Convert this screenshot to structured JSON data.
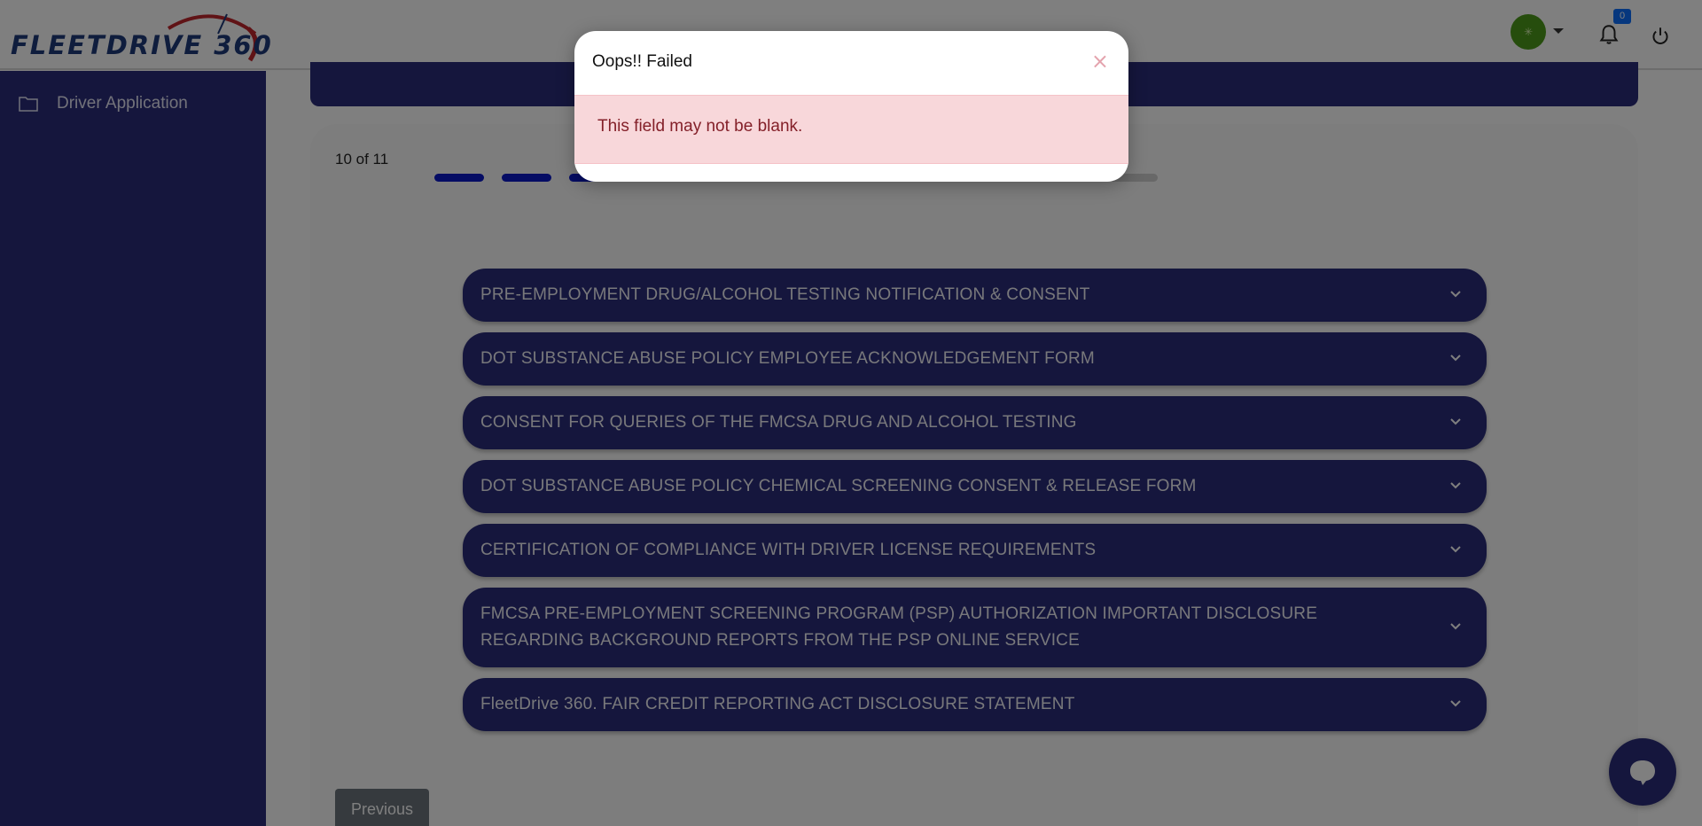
{
  "header": {
    "logo_text": "FLEETDRIVE 360",
    "notification_count": "0",
    "avatar_glyph": "✳"
  },
  "sidebar": {
    "items": [
      {
        "label": "Driver Application",
        "icon": "folder-icon"
      }
    ]
  },
  "main": {
    "step_text": "10 of 11",
    "progress": {
      "current": 10,
      "total": 11
    },
    "accordions": [
      {
        "label": "PRE-EMPLOYMENT DRUG/ALCOHOL TESTING NOTIFICATION & CONSENT"
      },
      {
        "label": "DOT SUBSTANCE ABUSE POLICY EMPLOYEE ACKNOWLEDGEMENT FORM"
      },
      {
        "label": "CONSENT FOR QUERIES OF THE FMCSA DRUG AND ALCOHOL TESTING"
      },
      {
        "label": "DOT SUBSTANCE ABUSE POLICY CHEMICAL SCREENING CONSENT & RELEASE FORM"
      },
      {
        "label": "CERTIFICATION OF COMPLIANCE WITH DRIVER LICENSE REQUIREMENTS"
      },
      {
        "label": "FMCSA PRE-EMPLOYMENT SCREENING PROGRAM (PSP) AUTHORIZATION IMPORTANT DISCLOSURE REGARDING BACKGROUND REPORTS FROM THE PSP ONLINE SERVICE"
      },
      {
        "label": "FleetDrive 360. FAIR CREDIT REPORTING ACT DISCLOSURE STATEMENT"
      }
    ],
    "previous_label": "Previous"
  },
  "modal": {
    "title": "Oops!! Failed",
    "close_glyph": "×",
    "message": "This field may not be blank."
  },
  "colors": {
    "brand_navy": "#2b2d7a",
    "progress_active": "#0b18c9",
    "alert_bg": "#f8d7da",
    "alert_text": "#842029"
  }
}
